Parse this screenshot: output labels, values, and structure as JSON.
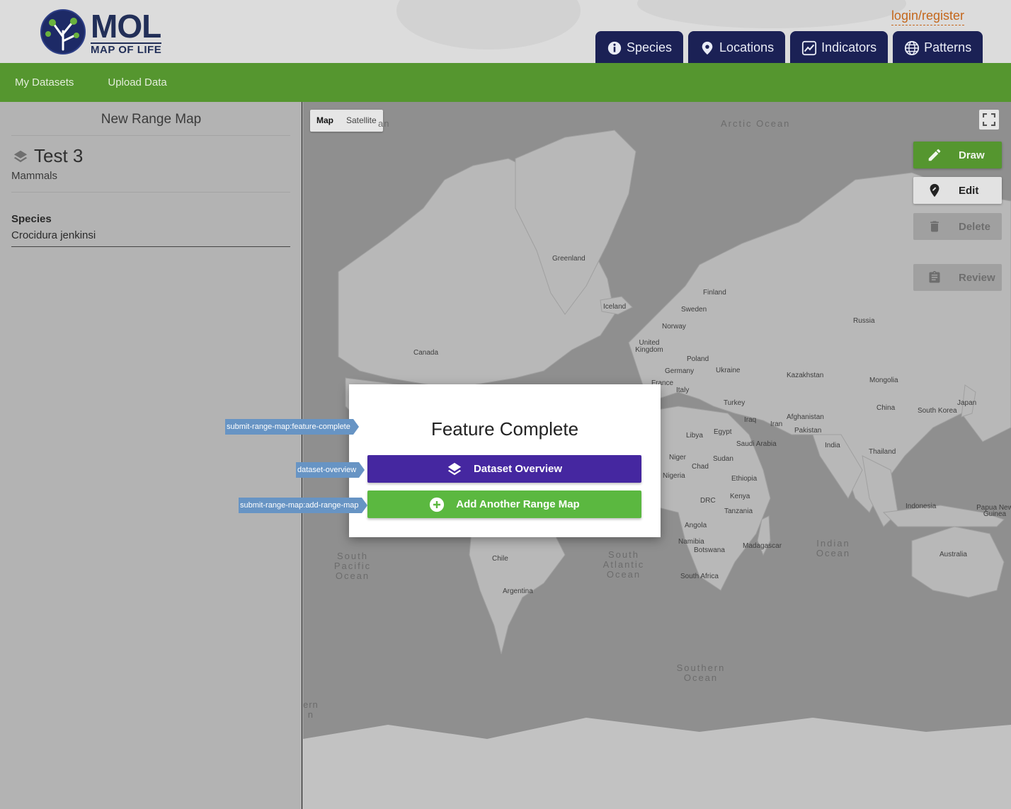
{
  "header": {
    "logo_title": "MOL",
    "logo_subtitle": "MAP OF LIFE",
    "login_label": "login/register",
    "tabs": [
      {
        "label": "Species",
        "icon": "info-icon"
      },
      {
        "label": "Locations",
        "icon": "location-pin-icon"
      },
      {
        "label": "Indicators",
        "icon": "trend-chart-icon"
      },
      {
        "label": "Patterns",
        "icon": "globe-icon"
      }
    ]
  },
  "subnav": {
    "items": [
      "My Datasets",
      "Upload Data"
    ]
  },
  "sidebar": {
    "panel_title": "New Range Map",
    "dataset_name": "Test 3",
    "dataset_category": "Mammals",
    "species_label": "Species",
    "species_value": "Crocidura jenkinsi"
  },
  "map": {
    "type_options": [
      "Map",
      "Satellite"
    ],
    "selected_type": "Map",
    "tools": {
      "draw": "Draw",
      "edit": "Edit",
      "delete": "Delete",
      "review": "Review"
    },
    "country_labels": [
      "Greenland",
      "Iceland",
      "Finland",
      "Sweden",
      "Norway",
      "Russia",
      "United Kingdom",
      "Poland",
      "Ukraine",
      "Germany",
      "France",
      "Italy",
      "Kazakhstan",
      "Mongolia",
      "China",
      "South Korea",
      "Japan",
      "Turkey",
      "Afghanistan",
      "Iraq",
      "Iran",
      "Pakistan",
      "India",
      "Thailand",
      "Libya",
      "Egypt",
      "Saudi Arabia",
      "Niger",
      "Chad",
      "Sudan",
      "Nigeria",
      "Ethiopia",
      "Kenya",
      "DRC",
      "Tanzania",
      "Angola",
      "Namibia",
      "Botswana",
      "Madagascar",
      "South Africa",
      "Indonesia",
      "Papua New Guinea",
      "Australia",
      "Canada",
      "Chile",
      "Argentina"
    ],
    "ocean_labels": [
      "Arctic Ocean",
      "South Pacific Ocean",
      "South Atlantic Ocean",
      "Indian Ocean",
      "Southern Ocean"
    ],
    "cut_labels": [
      "an",
      "s",
      "ern\nn"
    ]
  },
  "modal": {
    "title": "Feature Complete",
    "dataset_overview_label": "Dataset Overview",
    "add_range_map_label": "Add Another Range Map",
    "colors": {
      "overview": "#4527a0",
      "add": "#5bb840"
    }
  },
  "debug_tags": {
    "feature_complete": "submit-range-map:feature-complete",
    "dataset_overview": "dataset-overview",
    "add_range_map": "submit-range-map:add-range-map"
  }
}
